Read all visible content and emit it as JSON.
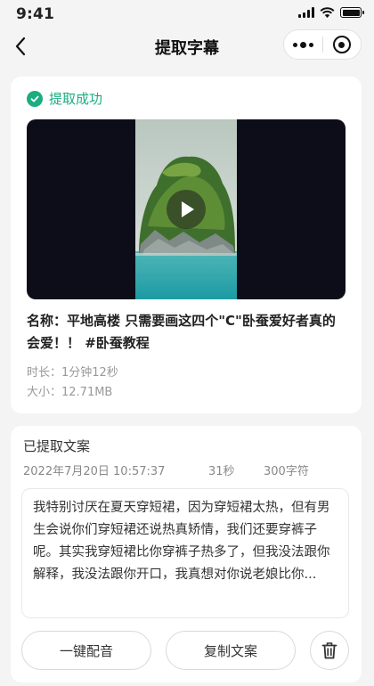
{
  "status_bar": {
    "time": "9:41"
  },
  "nav": {
    "title": "提取字幕"
  },
  "result": {
    "status_text": "提取成功",
    "video_title": "名称：平地高楼 只需要画这四个\"C\"卧蚕爱好者真的会爱！！ #卧蚕教程",
    "duration": "时长：1分钟12秒",
    "size": "大小：12.71MB"
  },
  "transcript": {
    "section_title": "已提取文案",
    "date": "2022年7月20日 10:57:37",
    "length": "31秒",
    "char_count": "300字符",
    "text": "我特别讨厌在夏天穿短裙，因为穿短裙太热，但有男生会说你们穿短裙还说热真矫情，我们还要穿裤子呢。其实我穿短裙比你穿裤子热多了，但我没法跟你解释，我没法跟你开口，我真想对你说老娘比你..."
  },
  "actions": {
    "dub_label": "一键配音",
    "copy_label": "复制文案"
  },
  "colors": {
    "accent": "#1aad80",
    "video_bg": "#0d0d1a"
  }
}
